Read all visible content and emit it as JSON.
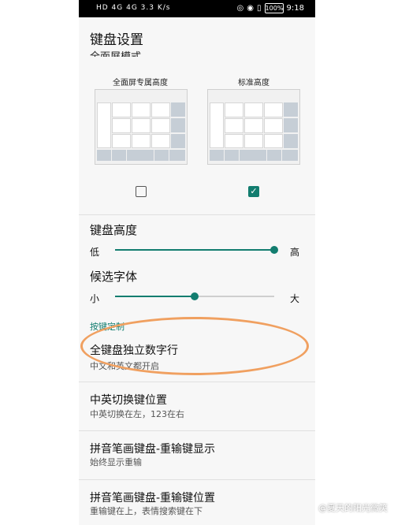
{
  "status_bar": {
    "left": "HD 4G 4G 3.3 K/s",
    "battery": "100%",
    "time": "9:18"
  },
  "header": {
    "title": "键盘设置"
  },
  "fullscreen_mode": {
    "title_partial": "全面屏模式",
    "options": [
      {
        "label": "全面屏专属高度",
        "checked": false
      },
      {
        "label": "标准高度",
        "checked": true
      }
    ]
  },
  "keyboard_height": {
    "title": "键盘高度",
    "min_label": "低",
    "max_label": "高",
    "value_fraction": 1.0
  },
  "candidate_font": {
    "title": "候选字体",
    "min_label": "小",
    "max_label": "大",
    "value_fraction": 0.5
  },
  "section_key_custom": "按键定制",
  "items": [
    {
      "title": "全键盘独立数字行",
      "subtitle": "中文和英文都开启"
    },
    {
      "title": "中英切换键位置",
      "subtitle": "中英切换在左，123在右"
    },
    {
      "title": "拼音笔画键盘-重输键显示",
      "subtitle": "始终显示重输"
    },
    {
      "title": "拼音笔画键盘-重输键位置",
      "subtitle": "重输键在上，表情搜索键在下"
    }
  ],
  "watermark": "@夏天的阳光微笑",
  "colors": {
    "accent": "#127d6f",
    "annotation": "#f0a060"
  }
}
